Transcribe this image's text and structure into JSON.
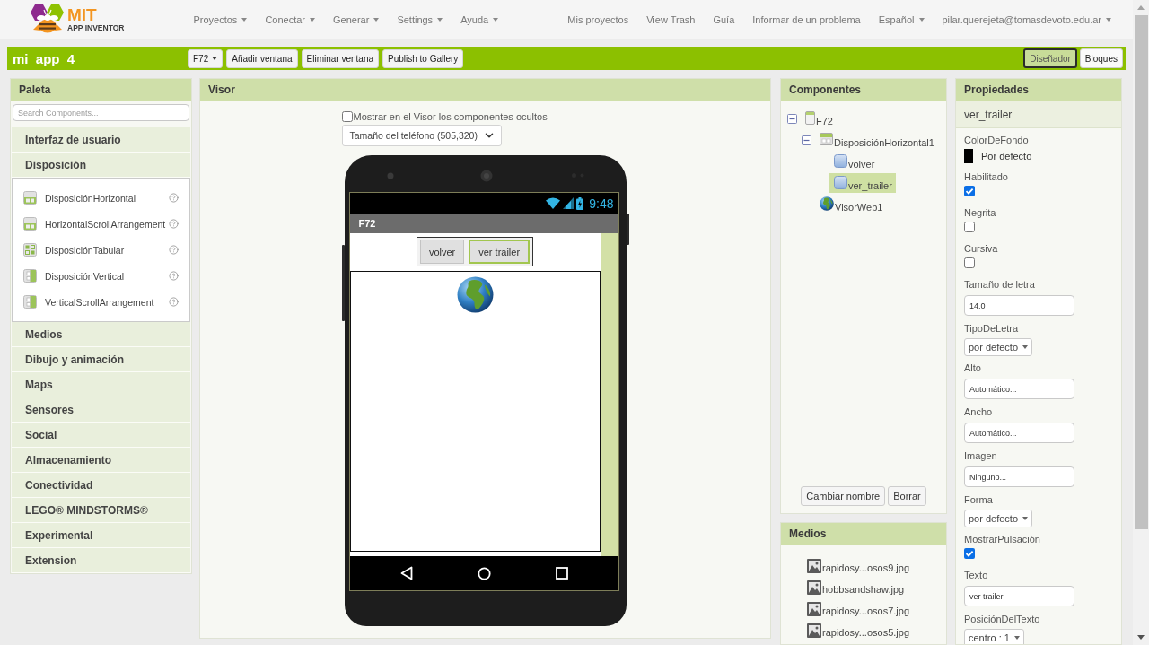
{
  "top_nav": {
    "logo": {
      "title": "MIT",
      "subtitle": "APP INVENTOR"
    },
    "menus": [
      {
        "label": "Proyectos",
        "dropdown": true
      },
      {
        "label": "Conectar",
        "dropdown": true
      },
      {
        "label": "Generar",
        "dropdown": true
      },
      {
        "label": "Settings",
        "dropdown": true
      },
      {
        "label": "Ayuda",
        "dropdown": true
      }
    ],
    "links": [
      {
        "label": "Mis proyectos",
        "dropdown": false
      },
      {
        "label": "View Trash",
        "dropdown": false
      },
      {
        "label": "Guía",
        "dropdown": false
      },
      {
        "label": "Informar de un problema",
        "dropdown": false
      },
      {
        "label": "Español",
        "dropdown": true
      },
      {
        "label": "pilar.querejeta@tomasdevoto.edu.ar",
        "dropdown": true
      }
    ]
  },
  "toolbar": {
    "project": "mi_app_4",
    "buttons": [
      {
        "label": "F72",
        "dropdown": true
      },
      {
        "label": "Añadir ventana",
        "dropdown": false
      },
      {
        "label": "Eliminar ventana",
        "dropdown": false
      },
      {
        "label": "Publish to Gallery",
        "dropdown": false
      }
    ],
    "modes": [
      {
        "label": "Diseñador",
        "selected": true
      },
      {
        "label": "Bloques",
        "selected": false
      }
    ]
  },
  "palette": {
    "title": "Paleta",
    "search": {
      "placeholder": "Search Components..."
    },
    "categories": [
      {
        "label": "Interfaz de usuario"
      },
      {
        "label": "Disposición",
        "items": [
          {
            "label": "DisposiciónHorizontal",
            "kind": "horizontal"
          },
          {
            "label": "HorizontalScrollArrangement",
            "kind": "horizontal"
          },
          {
            "label": "DisposiciónTabular",
            "kind": "table"
          },
          {
            "label": "DisposiciónVertical",
            "kind": "vertical"
          },
          {
            "label": "VerticalScrollArrangement",
            "kind": "vertical"
          }
        ]
      },
      {
        "label": "Medios"
      },
      {
        "label": "Dibujo y animación"
      },
      {
        "label": "Maps"
      },
      {
        "label": "Sensores"
      },
      {
        "label": "Social"
      },
      {
        "label": "Almacenamiento"
      },
      {
        "label": "Conectividad"
      },
      {
        "label": "LEGO® MINDSTORMS®"
      },
      {
        "label": "Experimental"
      },
      {
        "label": "Extension"
      }
    ]
  },
  "viewer": {
    "title": "Visor",
    "show_hidden": {
      "label": "Mostrar en el Visor los componentes ocultos",
      "checked": false
    },
    "phone_size": {
      "value": "Tamaño del teléfono (505,320)"
    },
    "phone": {
      "time": "9:48",
      "screen_title": "F72",
      "buttons": [
        {
          "label": "volver",
          "selected": false
        },
        {
          "label": "ver trailer",
          "selected": true
        }
      ]
    }
  },
  "components": {
    "title": "Componentes",
    "tree": [
      {
        "label": "F72",
        "kind": "screen",
        "expanded": true,
        "selected": false,
        "children": [
          {
            "label": "DisposiciónHorizontal1",
            "kind": "horizontal",
            "expanded": true,
            "selected": false,
            "children": [
              {
                "label": "volver",
                "kind": "button",
                "selected": false
              },
              {
                "label": "ver_trailer",
                "kind": "button",
                "selected": true
              }
            ]
          },
          {
            "label": "VisorWeb1",
            "kind": "web",
            "selected": false
          }
        ]
      }
    ],
    "buttons": [
      "Cambiar nombre",
      "Borrar"
    ]
  },
  "media": {
    "title": "Medios",
    "files": [
      "rapidosy...osos9.jpg",
      "hobbsandshaw.jpg",
      "rapidosy...osos7.jpg",
      "rapidosy...osos5.jpg"
    ]
  },
  "properties": {
    "title": "Propiedades",
    "component": "ver_trailer",
    "items": [
      {
        "label": "ColorDeFondo",
        "kind": "color",
        "color": "#000000",
        "value": "Por defecto"
      },
      {
        "label": "Habilitado",
        "kind": "checkbox",
        "checked": true
      },
      {
        "label": "Negrita",
        "kind": "checkbox",
        "checked": false
      },
      {
        "label": "Cursiva",
        "kind": "checkbox",
        "checked": false
      },
      {
        "label": "Tamaño de letra",
        "kind": "text",
        "value": "14.0"
      },
      {
        "label": "TipoDeLetra",
        "kind": "dropdown",
        "value": "por defecto"
      },
      {
        "label": "Alto",
        "kind": "text",
        "value": "Automático..."
      },
      {
        "label": "Ancho",
        "kind": "text",
        "value": "Automático..."
      },
      {
        "label": "Imagen",
        "kind": "text",
        "value": "Ninguno..."
      },
      {
        "label": "Forma",
        "kind": "dropdown",
        "value": "por defecto"
      },
      {
        "label": "MostrarPulsación",
        "kind": "checkbox",
        "checked": true
      },
      {
        "label": "Texto",
        "kind": "text",
        "value": "ver trailer"
      },
      {
        "label": "PosiciónDelTexto",
        "kind": "dropdown",
        "value": "centro : 1"
      }
    ]
  }
}
